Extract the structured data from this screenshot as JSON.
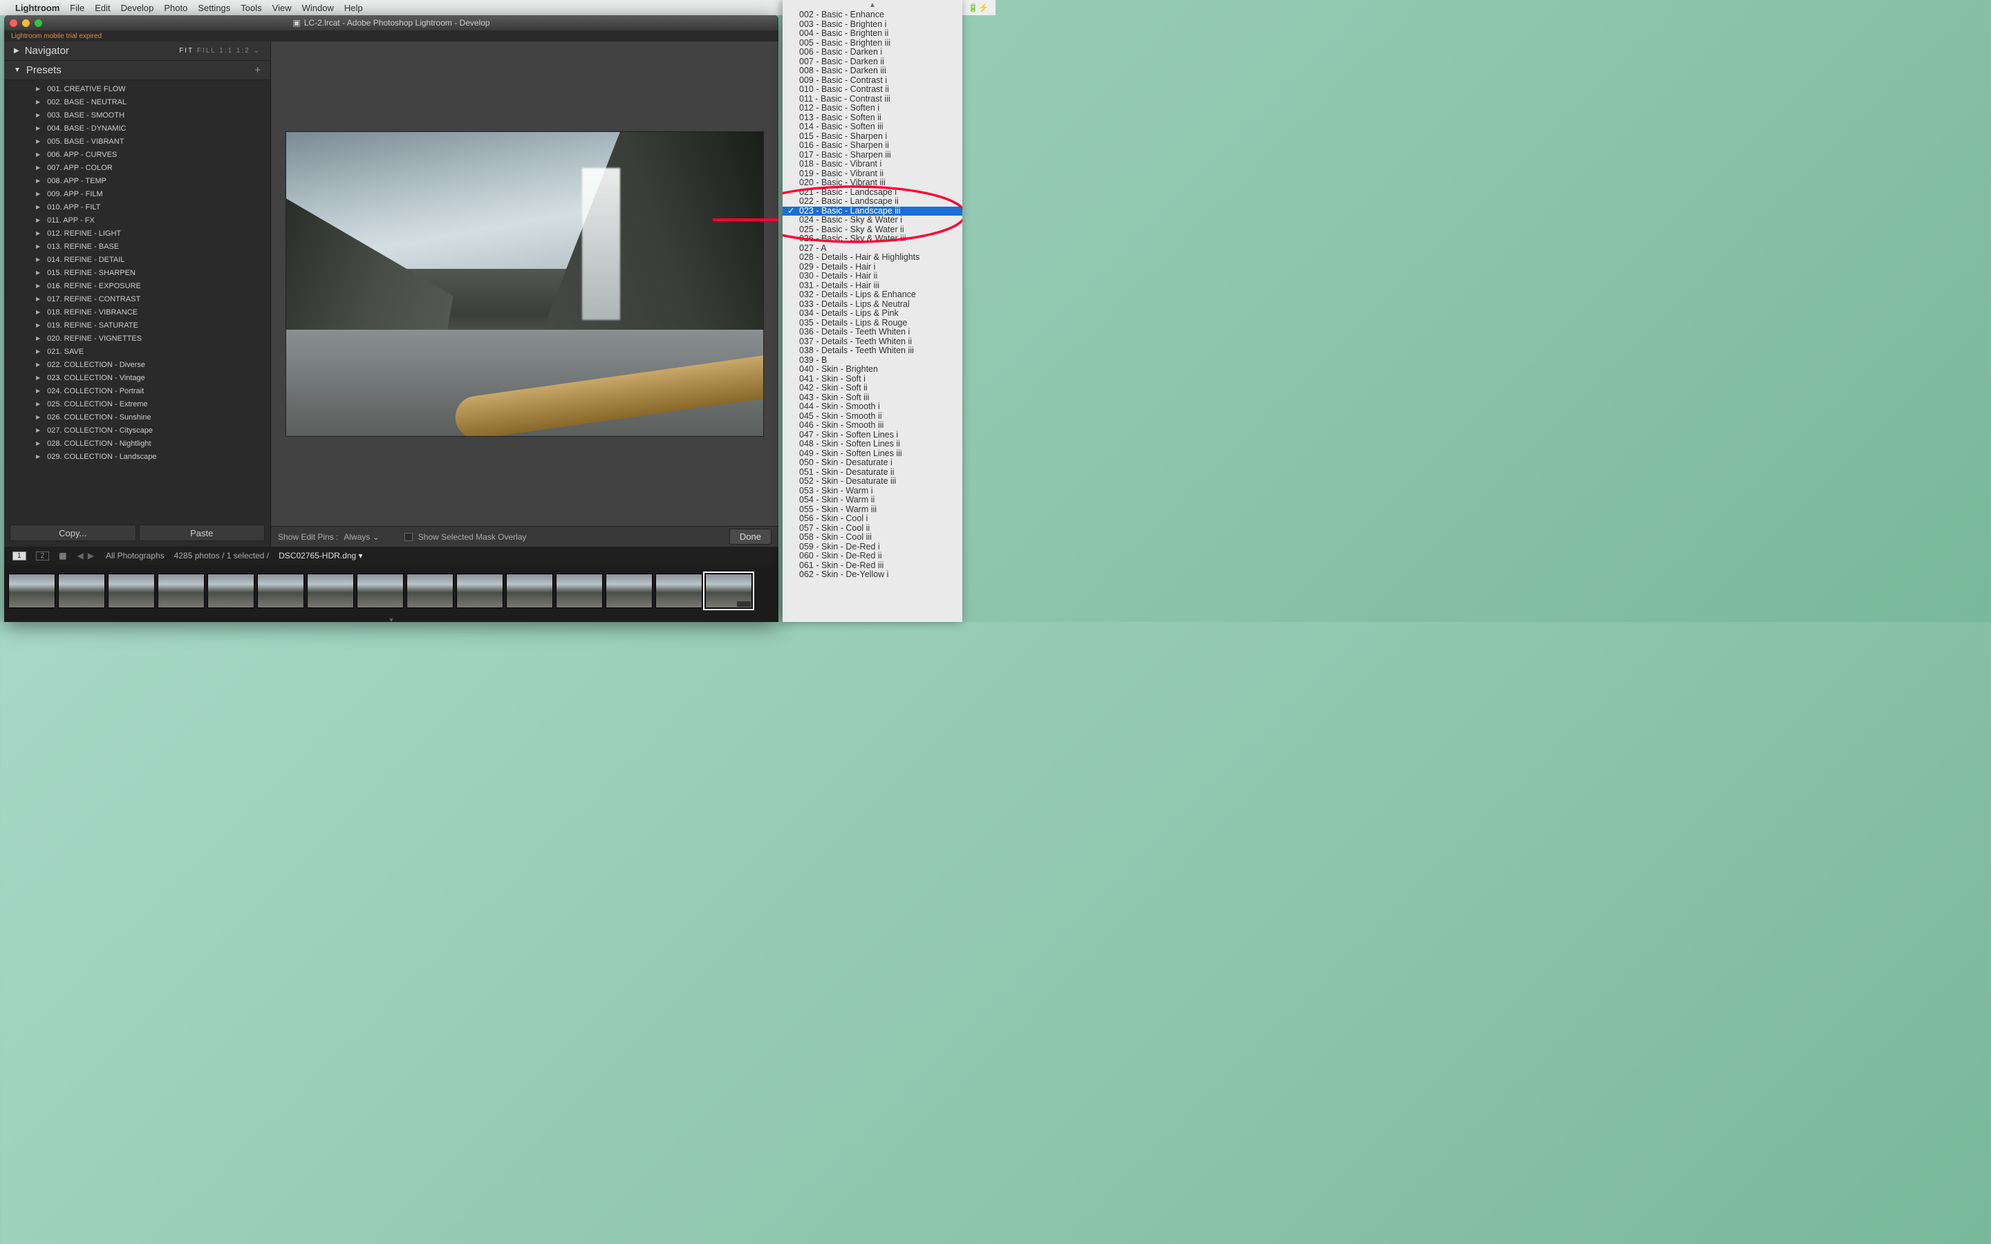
{
  "menubar": {
    "app": "Lightroom",
    "items": [
      "File",
      "Edit",
      "Develop",
      "Photo",
      "Settings",
      "Tools",
      "View",
      "Window",
      "Help"
    ],
    "battery": "100%"
  },
  "window": {
    "title": "LC-2.lrcat - Adobe Photoshop Lightroom - Develop",
    "trial": "Lightroom mobile trial expired"
  },
  "navigator": {
    "label": "Navigator",
    "zoom": {
      "fit": "FIT",
      "fill": "FILL",
      "one": "1:1",
      "two": "1:2"
    }
  },
  "presets": {
    "label": "Presets",
    "folders": [
      "001. CREATIVE FLOW",
      "002. BASE - NEUTRAL",
      "003. BASE - SMOOTH",
      "004. BASE - DYNAMIC",
      "005. BASE - VIBRANT",
      "006. APP - CURVES",
      "007. APP - COLOR",
      "008. APP - TEMP",
      "009. APP - FILM",
      "010. APP - FILT",
      "011. APP - FX",
      "012. REFINE - LIGHT",
      "013. REFINE - BASE",
      "014. REFINE - DETAIL",
      "015. REFINE - SHARPEN",
      "016. REFINE - EXPOSURE",
      "017. REFINE - CONTRAST",
      "018. REFINE - VIBRANCE",
      "019. REFINE - SATURATE",
      "020. REFINE - VIGNETTES",
      "021. SAVE",
      "022. COLLECTION - Diverse",
      "023. COLLECTION - Vintage",
      "024. COLLECTION - Portrait",
      "025. COLLECTION - Extreme",
      "026. COLLECTION - Sunshine",
      "027. COLLECTION - Cityscape",
      "028. COLLECTION - Nightlight",
      "029. COLLECTION - Landscape"
    ]
  },
  "buttons": {
    "copy": "Copy...",
    "paste": "Paste",
    "done": "Done"
  },
  "toolbar": {
    "editpins": "Show Edit Pins :",
    "always": "Always",
    "mask": "Show Selected Mask Overlay"
  },
  "filmstrip": {
    "source": "All Photographs",
    "count": "4285 photos / 1 selected /",
    "filename": "DSC02765-HDR.dng",
    "thumbCount": 15,
    "selectedIndex": 14
  },
  "dropdown": {
    "selectedIndex": 21,
    "items": [
      "002 - Basic - Enhance",
      "003 - Basic - Brighten i",
      "004 - Basic - Brighten ii",
      "005 - Basic - Brighten iii",
      "006 - Basic - Darken i",
      "007 - Basic - Darken ii",
      "008 - Basic - Darken iii",
      "009 - Basic - Contrast i",
      "010 - Basic - Contrast ii",
      "011 - Basic - Contrast iii",
      "012 - Basic - Soften i",
      "013 - Basic - Soften ii",
      "014 - Basic - Soften iii",
      "015 - Basic - Sharpen i",
      "016 - Basic - Sharpen ii",
      "017 - Basic - Sharpen iii",
      "018 - Basic - Vibrant i",
      "019 - Basic - Vibrant ii",
      "020 - Basic - Vibrant iii",
      "021 - Basic - Landcsape  i",
      "022 - Basic - Landscape ii",
      "023 - Basic - Landscape iii",
      "024 - Basic - Sky & Water i",
      "025 - Basic - Sky & Water ii",
      "026 - Basic - Sky & Water iii",
      "027 - A",
      "028 - Details - Hair & Highlights",
      "029 - Details - Hair i",
      "030 - Details - Hair ii",
      "031 - Details - Hair iii",
      "032 - Details - Lips & Enhance",
      "033 - Details - Lips & Neutral",
      "034 - Details - Lips & Pink",
      "035 - Details - Lips & Rouge",
      "036 - Details - Teeth Whiten i",
      "037 - Details - Teeth Whiten ii",
      "038 - Details - Teeth Whiten iii",
      "039 - B",
      "040 - Skin - Brighten",
      "041 - Skin - Soft i",
      "042 - Skin - Soft ii",
      "043 - Skin - Soft iii",
      "044 - Skin - Smooth i",
      "045 - Skin - Smooth ii",
      "046 - Skin - Smooth iii",
      "047 - Skin - Soften Lines i",
      "048 - Skin - Soften Lines ii",
      "049 - Skin - Soften Lines iii",
      "050 - Skin - Desaturate i",
      "051 - Skin - Desaturate ii",
      "052 - Skin - Desaturate iii",
      "053 - Skin - Warm i",
      "054 - Skin - Warm ii",
      "055 - Skin - Warm iii",
      "056 - Skin - Cool i",
      "057 - Skin - Cool ii",
      "058 - Skin - Cool iii",
      "059 - Skin - De-Red i",
      "060 - Skin - De-Red ii",
      "061 - Skin - De-Red iii",
      "062 - Skin - De-Yellow i"
    ]
  }
}
